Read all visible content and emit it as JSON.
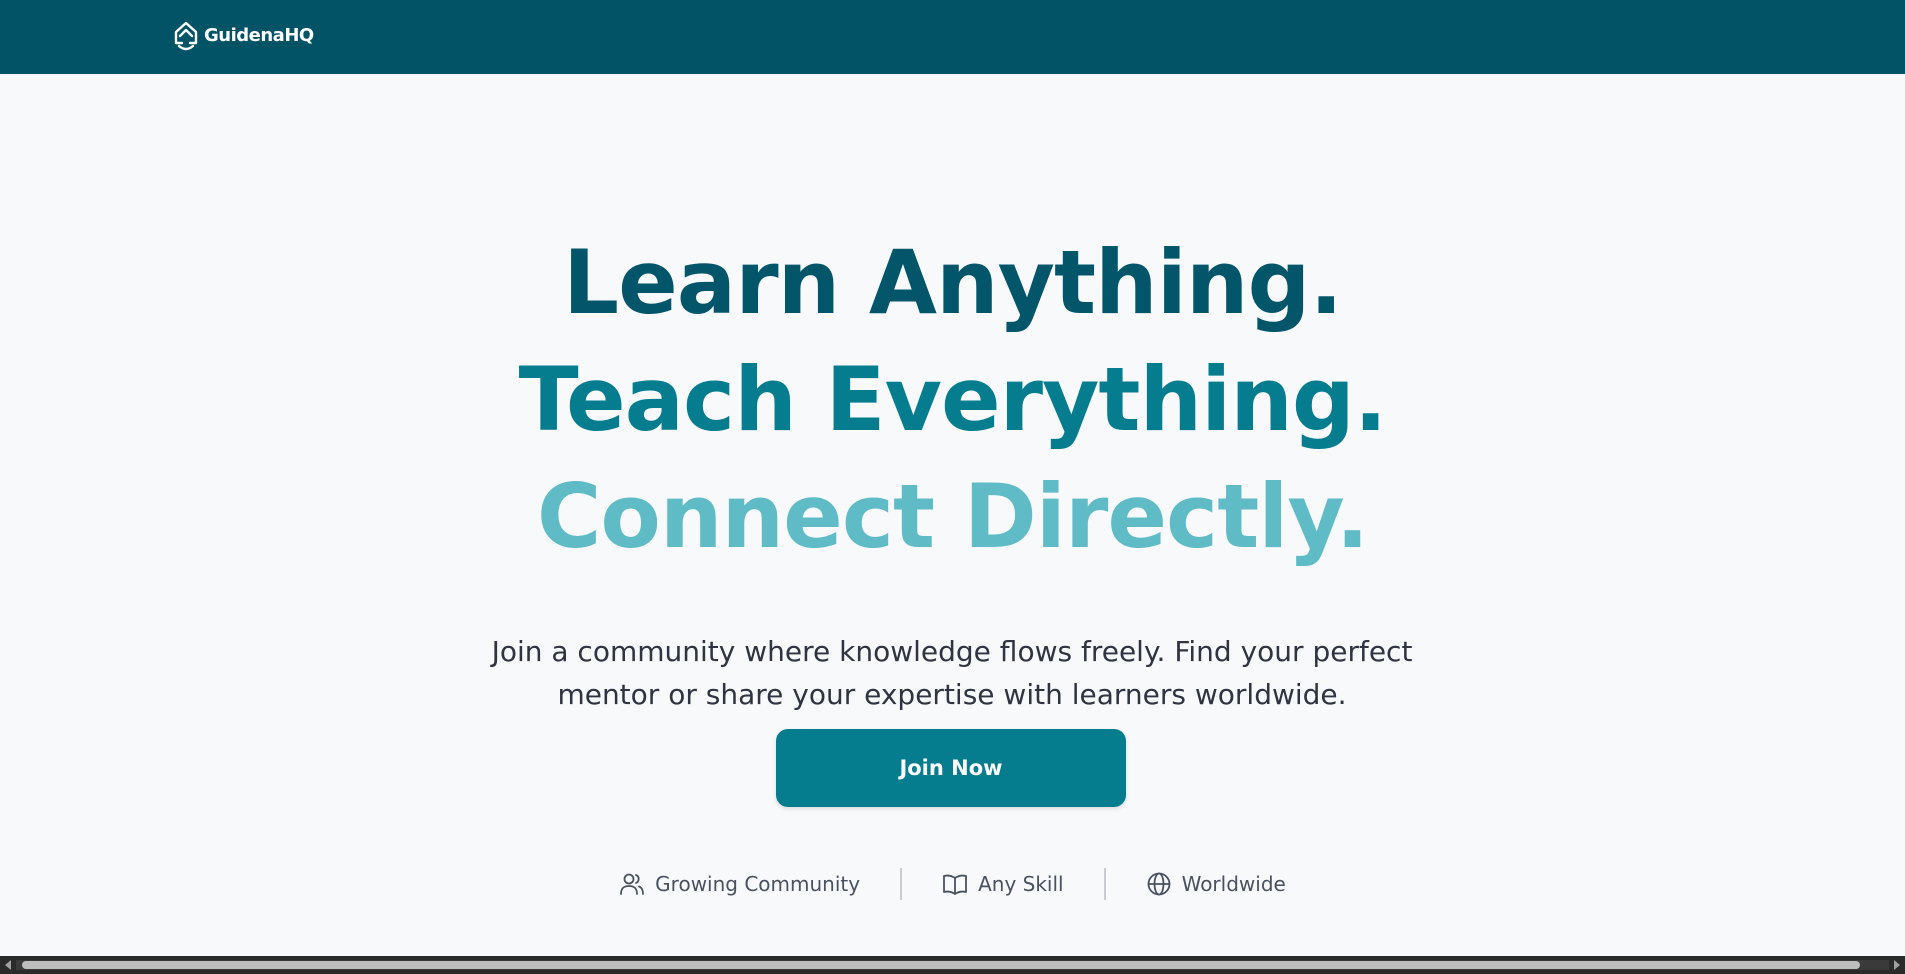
{
  "brand": {
    "name": "GuidenaHQ",
    "logo_icon": "home-up-icon",
    "color": "#035366"
  },
  "hero": {
    "line1": "Learn Anything.",
    "line2": "Teach Everything.",
    "line3": "Connect Directly.",
    "subtitle_line1": "Join a community where knowledge flows freely. Find your perfect",
    "subtitle_line2": "mentor or share your expertise with learners worldwide.",
    "cta_label": "Join Now",
    "colors": {
      "line1": "#03566a",
      "line2": "#057d8e",
      "line3": "#5fbcc7",
      "button": "#057d8e"
    }
  },
  "features": [
    {
      "label": "Growing Community",
      "icon": "users-icon"
    },
    {
      "label": "Any Skill",
      "icon": "book-icon"
    },
    {
      "label": "Worldwide",
      "icon": "globe-icon"
    }
  ]
}
